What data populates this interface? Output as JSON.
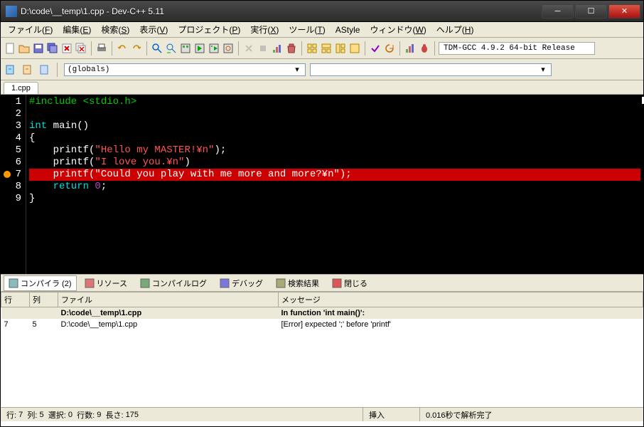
{
  "title": "D:\\code\\__temp\\1.cpp - Dev-C++ 5.11",
  "menu": [
    "ファイル(F)",
    "編集(E)",
    "検索(S)",
    "表示(V)",
    "プロジェクト(P)",
    "実行(X)",
    "ツール(T)",
    "AStyle",
    "ウィンドウ(W)",
    "ヘルプ(H)"
  ],
  "compiler_label": "TDM-GCC 4.9.2 64-bit Release",
  "scope_dropdown": "(globals)",
  "file_tab": "1.cpp",
  "code_lines": [
    {
      "n": "1",
      "spans": [
        {
          "cls": "c-green",
          "t": "#include <stdio.h>"
        }
      ]
    },
    {
      "n": "2",
      "spans": []
    },
    {
      "n": "3",
      "spans": [
        {
          "cls": "c-cyan",
          "t": "int"
        },
        {
          "cls": "c-white",
          "t": " main()"
        }
      ]
    },
    {
      "n": "4",
      "spans": [
        {
          "cls": "c-white",
          "t": "{"
        }
      ],
      "mk": true
    },
    {
      "n": "5",
      "spans": [
        {
          "cls": "c-white",
          "t": "    printf("
        },
        {
          "cls": "c-red",
          "t": "\"Hello my MASTER!¥n\""
        },
        {
          "cls": "c-white",
          "t": ");"
        }
      ]
    },
    {
      "n": "6",
      "spans": [
        {
          "cls": "c-white",
          "t": "    printf("
        },
        {
          "cls": "c-red",
          "t": "\"I love you.¥n\""
        },
        {
          "cls": "c-white",
          "t": ")"
        }
      ]
    },
    {
      "n": "7",
      "spans": [
        {
          "cls": "c-white",
          "t": "    printf("
        },
        {
          "cls": "c-white",
          "t": "\"Could you play with me more and more?¥n\""
        },
        {
          "cls": "c-white",
          "t": ");"
        }
      ],
      "hl": true,
      "bp": true
    },
    {
      "n": "8",
      "spans": [
        {
          "cls": "c-cyan",
          "t": "    return"
        },
        {
          "cls": "c-purple",
          "t": " 0"
        },
        {
          "cls": "c-white",
          "t": ";"
        }
      ]
    },
    {
      "n": "9",
      "spans": [
        {
          "cls": "c-white",
          "t": "}"
        }
      ]
    }
  ],
  "panel_tabs": [
    {
      "label": "コンパイラ (2)",
      "active": true,
      "color": "#8bb"
    },
    {
      "label": "リソース",
      "color": "#d77"
    },
    {
      "label": "コンパイルログ",
      "color": "#7a7"
    },
    {
      "label": "デバッグ",
      "color": "#77d"
    },
    {
      "label": "検索結果",
      "color": "#aa7"
    },
    {
      "label": "閉じる",
      "color": "#d55"
    }
  ],
  "error_headers": [
    "行",
    "列",
    "ファイル",
    "メッセージ"
  ],
  "error_rows": [
    {
      "line": "",
      "col": "",
      "file": "D:\\code\\__temp\\1.cpp",
      "msg": "In function 'int main()':",
      "hdr": true
    },
    {
      "line": "7",
      "col": "5",
      "file": "D:\\code\\__temp\\1.cpp",
      "msg": "[Error] expected ';' before 'printf'",
      "hdr": false
    }
  ],
  "status": {
    "line_label": "行:",
    "line": "7",
    "col_label": "列:",
    "col": "5",
    "sel_label": "選択:",
    "sel": "0",
    "lines_label": "行数:",
    "lines": "9",
    "len_label": "長さ:",
    "len": "175",
    "insert": "挿入",
    "parse": "0.016秒で解析完了"
  }
}
